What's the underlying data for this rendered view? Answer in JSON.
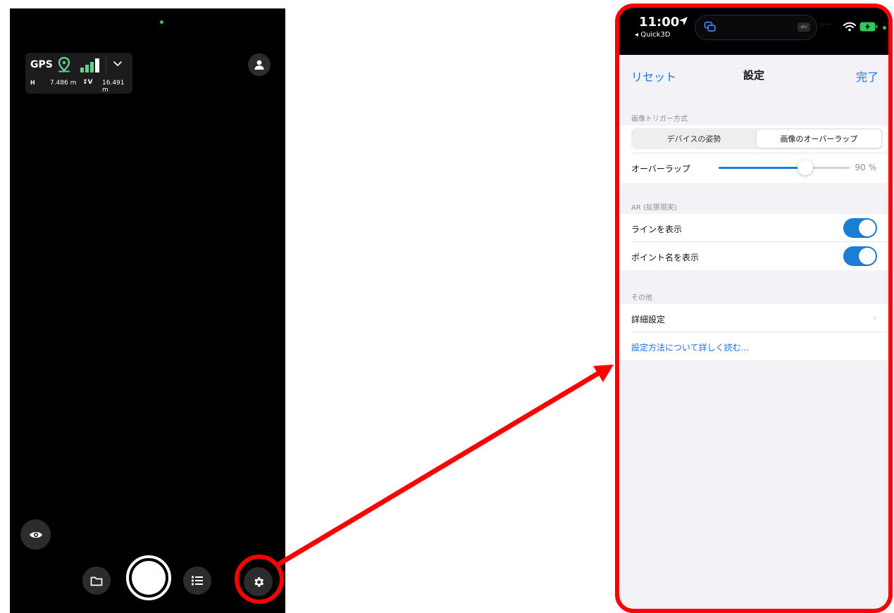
{
  "camera": {
    "gps": {
      "label": "GPS",
      "h_icon": "H",
      "horizontal": "7.486 m",
      "v_icon": "↕V",
      "vertical": "16.491 m",
      "signal_color": "#5fd38d"
    },
    "icons": {
      "profile": "person-icon",
      "eye": "eye-icon",
      "folder": "folder-icon",
      "list": "list-icon",
      "settings": "gear-icon"
    }
  },
  "annotation": {
    "color": "#ff0000"
  },
  "settings": {
    "status": {
      "time": "11:00",
      "back_app": "◂ Quick3D",
      "tv_badge": "atv",
      "dots": "....",
      "battery_color": "#34c759"
    },
    "nav": {
      "reset": "リセット",
      "title": "設定",
      "done": "完了"
    },
    "image_trigger": {
      "header": "画像トリガー方式",
      "segments": [
        "デバイスの姿勢",
        "画像のオーバーラップ"
      ],
      "selected": "画像のオーバーラップ"
    },
    "overlap": {
      "label": "オーバーラップ",
      "value_text": "90 %",
      "fraction": 0.66
    },
    "ar": {
      "header": "AR (拡張現実)",
      "show_lines": {
        "label": "ラインを表示",
        "on": true
      },
      "show_point_names": {
        "label": "ポイント名を表示",
        "on": true
      }
    },
    "other": {
      "header": "その他",
      "advanced": "詳細設定",
      "chevron": "›",
      "learn_more": "設定方法について詳しく読む..."
    },
    "accent": "#1a73e8"
  }
}
